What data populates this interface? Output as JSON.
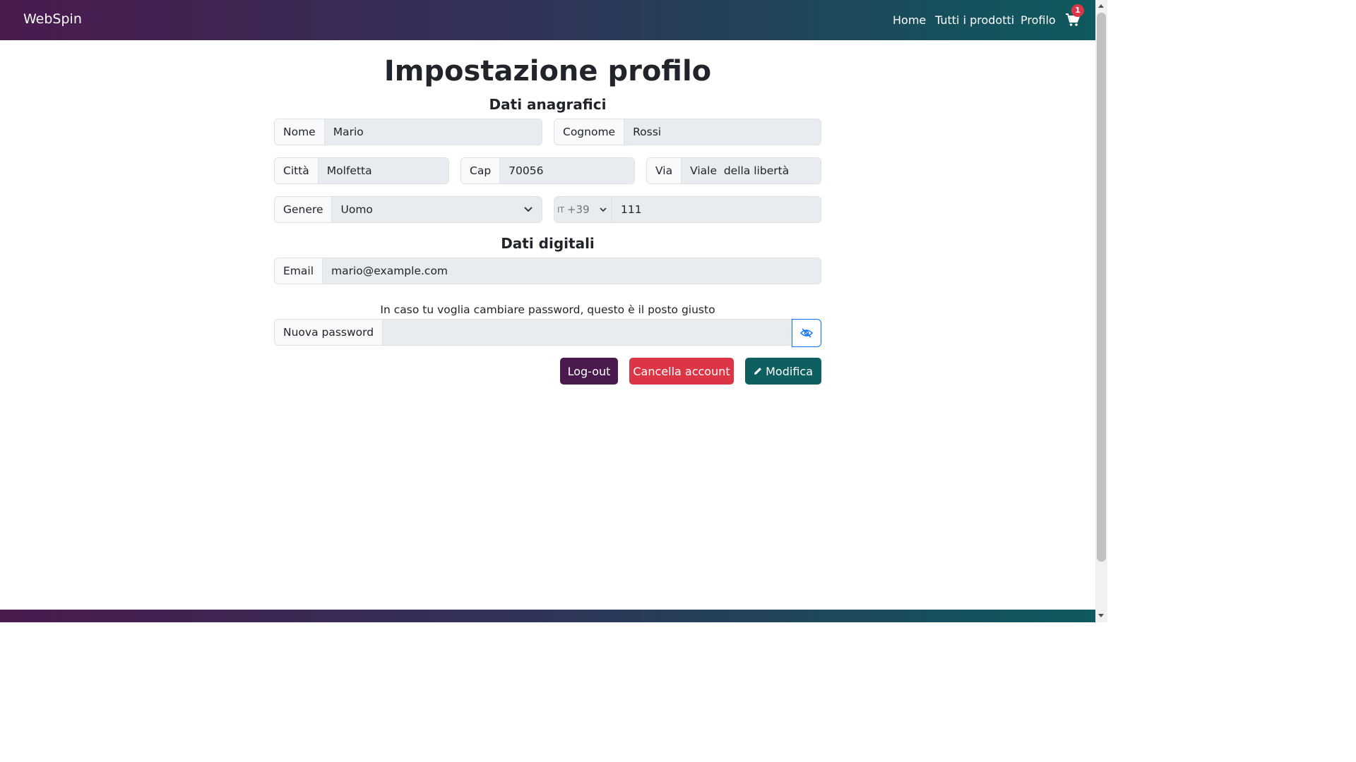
{
  "navbar": {
    "brand": "WebSpin",
    "links": [
      "Home",
      "Tutti i prodotti",
      "Profilo"
    ],
    "cart_count": "1"
  },
  "page": {
    "title": "Impostazione profilo",
    "section_personal": "Dati anagrafici",
    "section_digital": "Dati digitali"
  },
  "fields": {
    "nome": {
      "label": "Nome",
      "value": "Mario"
    },
    "cognome": {
      "label": "Cognome",
      "value": "Rossi"
    },
    "citta": {
      "label": "Città",
      "value": "Molfetta"
    },
    "cap": {
      "label": "Cap",
      "value": "70056"
    },
    "via": {
      "label": "Via",
      "value": "Viale  della libertà"
    },
    "genere": {
      "label": "Genere",
      "value": "Uomo"
    },
    "phone": {
      "flag": "IT",
      "prefix": "+39",
      "value": "111"
    },
    "email": {
      "label": "Email",
      "value": "mario@example.com"
    },
    "password": {
      "label": "Nuova password",
      "value": ""
    }
  },
  "password_hint": "In caso tu voglia cambiare password, questo è il posto giusto",
  "buttons": {
    "logout": "Log-out",
    "delete": "Cancella account",
    "edit": "Modifica"
  },
  "colors": {
    "logout": "#4a1a4f",
    "delete": "#dc3545",
    "edit": "#0e5f5f"
  }
}
